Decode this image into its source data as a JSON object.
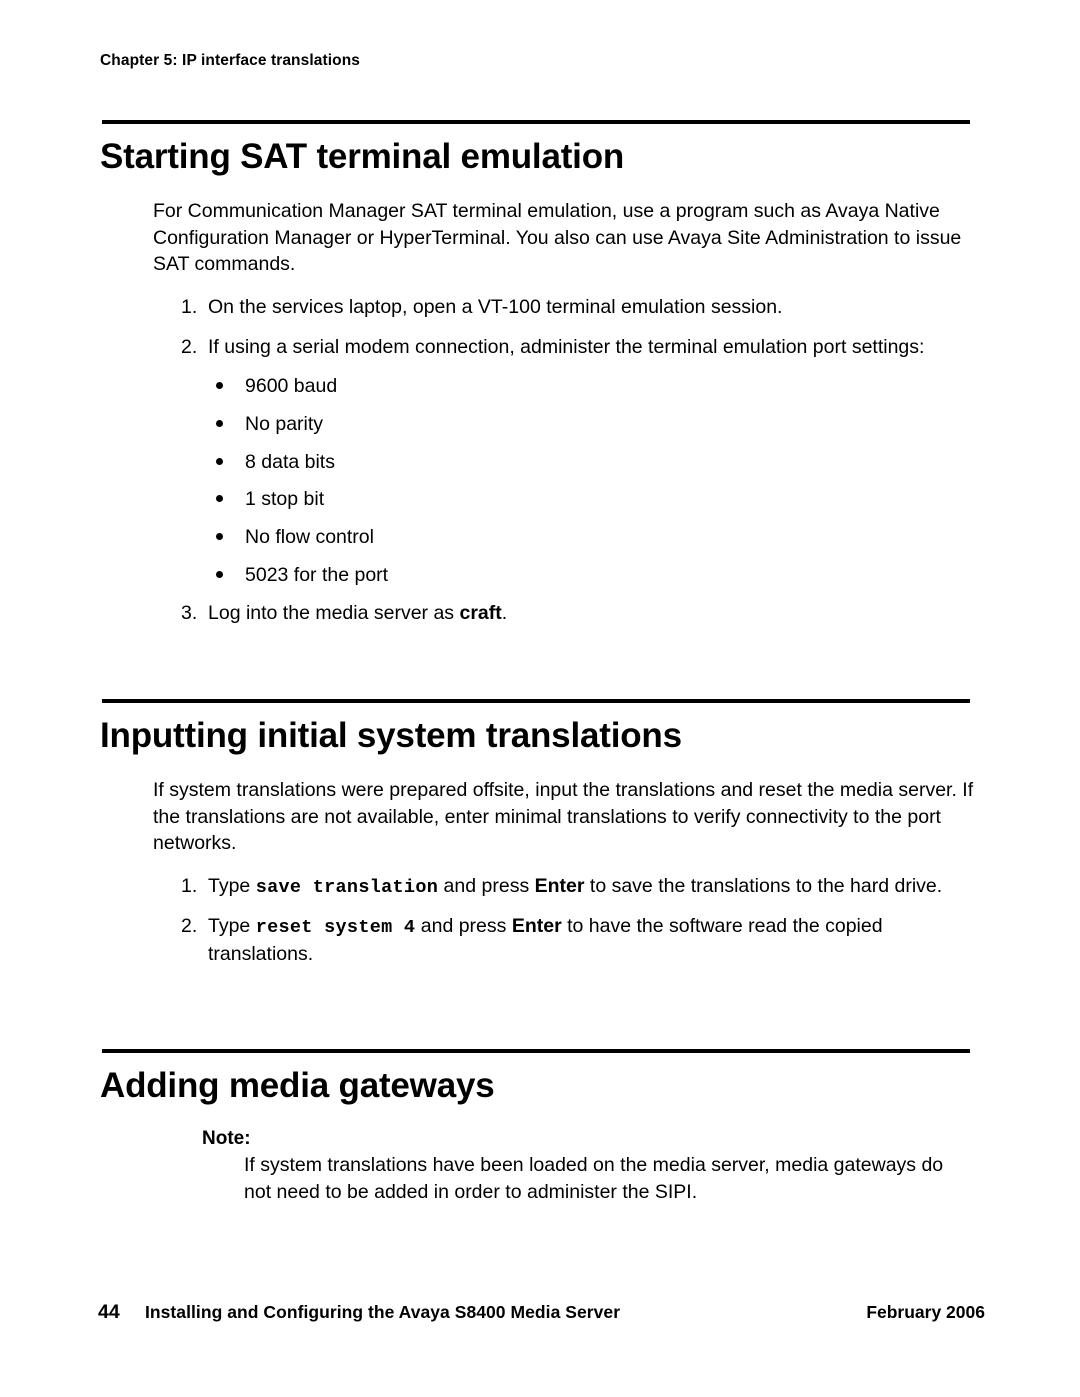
{
  "document": {
    "running_header": "Chapter 5: IP interface translations"
  },
  "sections": [
    {
      "title": "Starting SAT terminal emulation",
      "intro": "For Communication Manager SAT terminal emulation, use a program such as Avaya Native Configuration Manager or HyperTerminal. You also can use Avaya Site Administration to issue SAT commands.",
      "steps": [
        {
          "number": "1.",
          "text": "On the services laptop, open a VT-100 terminal emulation session."
        },
        {
          "number": "2.",
          "text": "If using a serial modem connection, administer the terminal emulation port settings:"
        },
        {
          "number": "3.",
          "text_before": "Log into the media server as ",
          "bold": "craft",
          "text_after": "."
        }
      ],
      "bullets": [
        "9600 baud",
        "No parity",
        "8 data bits",
        "1 stop bit",
        "No flow control",
        "5023 for the port"
      ]
    },
    {
      "title": "Inputting initial system translations",
      "intro": "If system translations were prepared offsite, input the translations and reset the media server. If the translations are not available, enter minimal translations to verify connectivity to the port networks.",
      "steps": [
        {
          "number": "1.",
          "text_before": "Type ",
          "command": "save translation",
          "text_mid": " and press ",
          "keyword": "Enter",
          "text_after": " to save the translations to the hard drive."
        },
        {
          "number": "2.",
          "text_before": "Type ",
          "command": "reset system 4",
          "text_mid": " and press ",
          "keyword": "Enter",
          "text_after": " to have the software read the copied translations."
        }
      ]
    },
    {
      "title": "Adding media gateways",
      "note": {
        "label": "Note:",
        "body": "If system translations have been loaded on the media server, media gateways do not need to be added in order to administer the SIPI."
      }
    }
  ],
  "footer": {
    "page_number": "44",
    "title": "Installing and Configuring the Avaya S8400 Media Server",
    "date": "February 2006"
  }
}
